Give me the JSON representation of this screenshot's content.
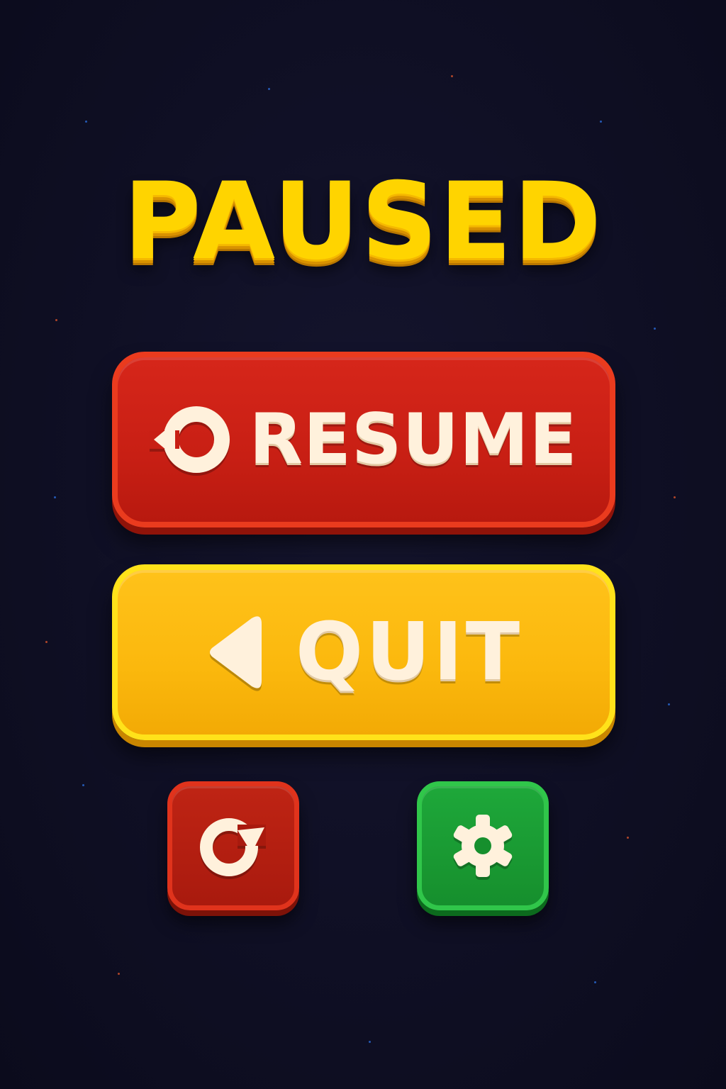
{
  "screen": {
    "title": "PAUSED",
    "background_color": "#0f0f24"
  },
  "buttons": {
    "resume": {
      "label": "RESUME",
      "icon": "resume-icon",
      "color": "#c81f14"
    },
    "quit": {
      "label": "QUIT",
      "icon": "back-triangle-icon",
      "color": "#fbb80d"
    },
    "restart": {
      "icon": "restart-icon",
      "color": "#a91a0e"
    },
    "settings": {
      "icon": "gear-icon",
      "color": "#168f2d"
    }
  },
  "colors": {
    "title": "#ffd400",
    "label": "#fff1dc"
  }
}
